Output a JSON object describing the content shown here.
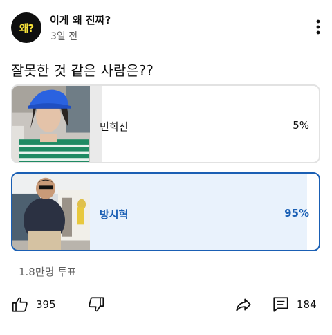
{
  "channel": {
    "avatar_text": "왜?",
    "name": "이게 왜 진짜?",
    "time": "3일 전"
  },
  "post": {
    "question": "잘못한 것 같은 사람은??"
  },
  "poll": {
    "options": [
      {
        "label": "민희진",
        "percent": "5%",
        "fraction": 0.05,
        "selected": false
      },
      {
        "label": "방시혁",
        "percent": "95%",
        "fraction": 0.95,
        "selected": true
      }
    ],
    "votes": "1.8만명 투표"
  },
  "actions": {
    "like_count": "395",
    "comment_count": "184"
  },
  "icons": [
    "more-vert-icon",
    "thumbs-up-icon",
    "thumbs-down-icon",
    "share-icon",
    "comment-icon"
  ],
  "colors": {
    "accent": "#1a5fb4",
    "selected_fill": "#e9f2fc",
    "unselected_fill": "#eaeaea"
  }
}
